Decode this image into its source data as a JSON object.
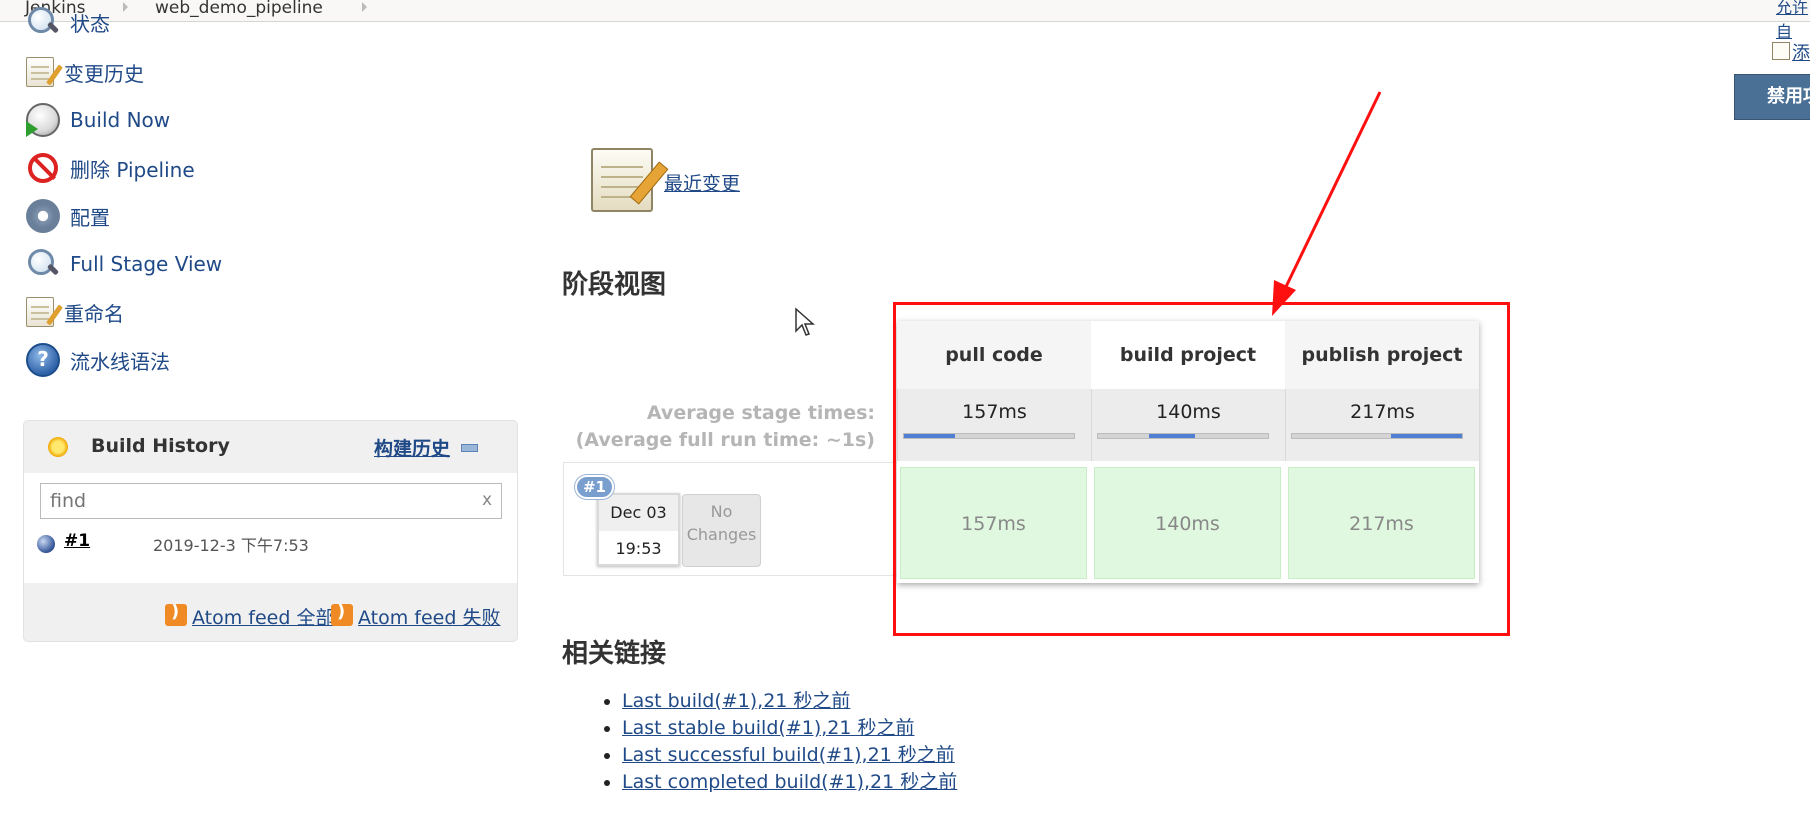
{
  "breadcrumb": {
    "items": [
      "Jenkins",
      "web_demo_pipeline"
    ]
  },
  "sidebar": {
    "tasks": [
      {
        "label": "状态",
        "icon": "search-icon"
      },
      {
        "label": "变更历史",
        "icon": "notepad-icon"
      },
      {
        "label": "Build Now",
        "icon": "clock-icon"
      },
      {
        "label": "删除 Pipeline",
        "icon": "forbidden-icon"
      },
      {
        "label": "配置",
        "icon": "gear-icon"
      },
      {
        "label": "Full Stage View",
        "icon": "search-icon"
      },
      {
        "label": "重命名",
        "icon": "notepad-icon"
      },
      {
        "label": "流水线语法",
        "icon": "help-icon"
      }
    ]
  },
  "build_history": {
    "title": "Build History",
    "trend_link": "构建历史",
    "find_placeholder": "find",
    "find_clear": "x",
    "builds": [
      {
        "number": "#1",
        "time": "2019-12-3 下午7:53"
      }
    ],
    "feeds": {
      "all": "Atom feed 全部",
      "failures": "Atom feed 失败"
    }
  },
  "main": {
    "recent_changes": "最近变更",
    "stage_view_title": "阶段视图",
    "related_links_title": "相关链接"
  },
  "stage_view": {
    "avg_stage_label": "Average stage times:",
    "avg_full_label": "(Average full run time: ~1s)",
    "stages": [
      {
        "name": "pull code",
        "avg": "157ms",
        "bar_fraction": 0.3,
        "cell": "157ms"
      },
      {
        "name": "build project",
        "avg": "140ms",
        "bar_fraction": 0.27,
        "cell": "140ms"
      },
      {
        "name": "publish project",
        "avg": "217ms",
        "bar_fraction": 0.42,
        "cell": "217ms"
      }
    ],
    "run": {
      "badge": "#1",
      "date": "Dec 03",
      "time": "19:53",
      "changes_line1": "No",
      "changes_line2": "Changes"
    }
  },
  "related_links": [
    {
      "label": "Last build(#1),21 秒之前"
    },
    {
      "label": "Last stable build(#1),21 秒之前"
    },
    {
      "label": "Last successful build(#1),21 秒之前"
    },
    {
      "label": "Last completed build(#1),21 秒之前"
    }
  ],
  "right_edge": {
    "top_link": "允许自",
    "add_description": "添",
    "disable_button": "禁用项"
  },
  "colors": {
    "link": "#204a87",
    "stage_success": "#e0f8df",
    "bar_fill": "#4f7fd3",
    "annotation": "#ff1010"
  }
}
